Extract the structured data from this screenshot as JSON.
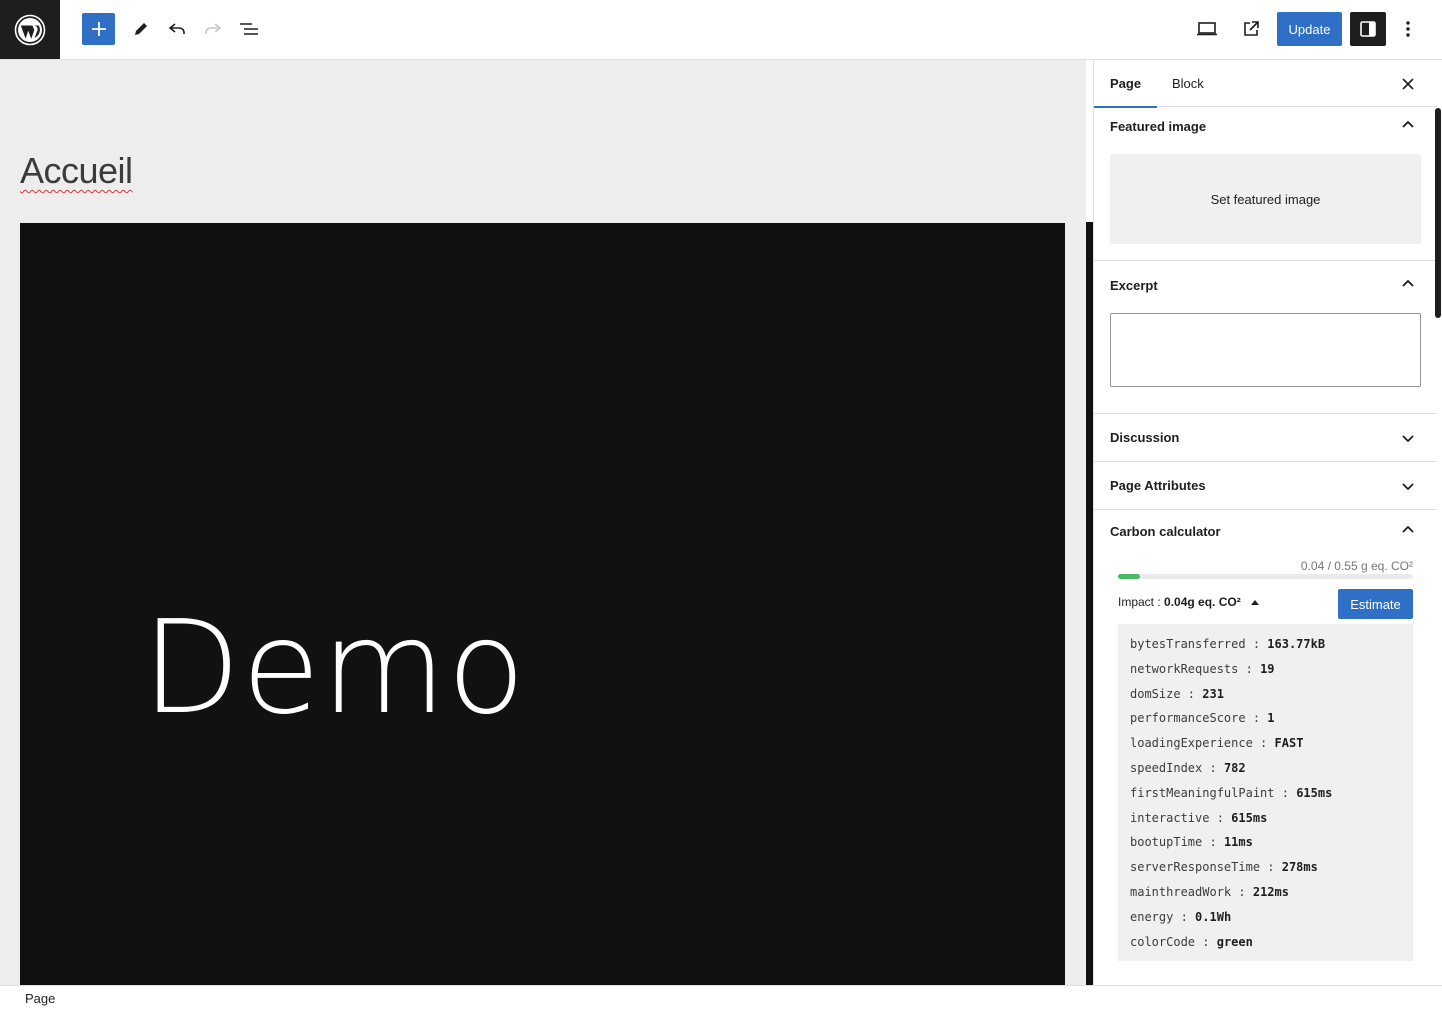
{
  "toolbar": {
    "update_label": "Update",
    "icons": [
      "wordpress-icon",
      "plus-icon",
      "pencil-icon",
      "undo-icon",
      "redo-icon",
      "list-view-icon",
      "desktop-icon",
      "external-icon",
      "sidebar-icon",
      "more-vertical-icon"
    ]
  },
  "canvas": {
    "title": "Accueil",
    "cover_text": "Demo"
  },
  "sidebar": {
    "tabs": [
      {
        "label": "Page",
        "active": true
      },
      {
        "label": "Block",
        "active": false
      }
    ],
    "featured_image": {
      "title": "Featured image",
      "button": "Set featured image",
      "expanded": true
    },
    "excerpt": {
      "title": "Excerpt",
      "value": "",
      "expanded": true
    },
    "discussion": {
      "title": "Discussion",
      "expanded": false
    },
    "page_attributes": {
      "title": "Page Attributes",
      "expanded": false
    },
    "carbon": {
      "title": "Carbon calculator",
      "meter_label": "0.04 / 0.55 g eq. CO²",
      "meter_fraction": 0.073,
      "impact_label": "Impact : ",
      "impact_value": "0.04g eq. CO²",
      "estimate_label": "Estimate",
      "metrics": [
        {
          "key": "bytesTransferred",
          "value": "163.77kB"
        },
        {
          "key": "networkRequests",
          "value": "19"
        },
        {
          "key": "domSize",
          "value": "231"
        },
        {
          "key": "performanceScore",
          "value": "1"
        },
        {
          "key": "loadingExperience",
          "value": "FAST"
        },
        {
          "key": "speedIndex",
          "value": "782"
        },
        {
          "key": "firstMeaningfulPaint",
          "value": "615ms"
        },
        {
          "key": "interactive",
          "value": "615ms"
        },
        {
          "key": "bootupTime",
          "value": "11ms"
        },
        {
          "key": "serverResponseTime",
          "value": "278ms"
        },
        {
          "key": "mainthreadWork",
          "value": "212ms"
        },
        {
          "key": "energy",
          "value": "0.1Wh"
        },
        {
          "key": "colorCode",
          "value": "green"
        }
      ]
    }
  },
  "footer": {
    "breadcrumb": "Page"
  },
  "colors": {
    "accent": "#2f6fc6",
    "meter": "#4ab866",
    "dark": "#1e1e1e",
    "canvas_bg": "#ededed"
  }
}
